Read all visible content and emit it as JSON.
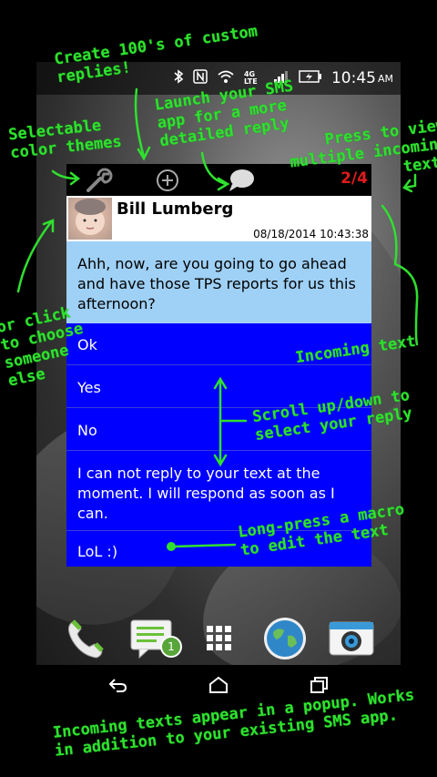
{
  "status_bar": {
    "time": "10:45",
    "ampm": "AM",
    "network": "4G LTE"
  },
  "popup": {
    "counter": "2/4",
    "contact_name": "Bill Lumberg",
    "timestamp": "08/18/2014 10:43:38",
    "incoming_text": "Ahh, now, are you going to go ahead and have those TPS reports for us this afternoon?",
    "replies": [
      "Ok",
      "Yes",
      "No",
      "I can not reply to your text at the moment. I will respond as soon as I can.",
      "LoL :)"
    ]
  },
  "dock": {
    "messages_badge": "1"
  },
  "annotations": {
    "custom_replies": "Create 100's of custom\nreplies!",
    "launch_sms": "Launch your SMS\napp for a more\ndetailed reply",
    "color_themes": "Selectable\ncolor themes",
    "view_multiple": "Press to view\nmultiple incoming\ntexts",
    "choose_someone": "or click\nto choose\nsomeone\nelse",
    "incoming_text": "Incoming text",
    "scroll_select": "Scroll up/down to\nselect your reply",
    "long_press": "Long-press a macro\nto edit the text",
    "footer": "Incoming texts appear in a popup. Works\nin addition to your existing SMS app."
  },
  "colors": {
    "annotation": "#2fe02f",
    "reply_bg": "#0000ff",
    "incoming_bg": "#9fd0f5",
    "counter": "#e01b1b"
  }
}
